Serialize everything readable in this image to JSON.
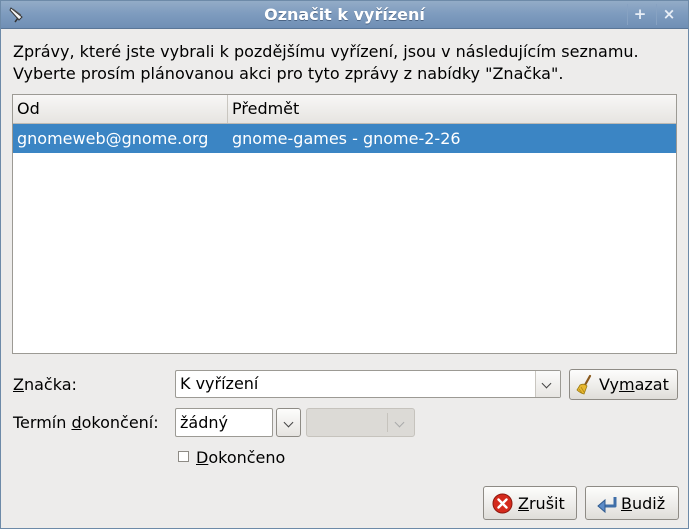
{
  "window": {
    "title": "Označit k vyřízení"
  },
  "intro": {
    "line1": "Zprávy, které jste vybrali k pozdějšímu vyřízení, jsou v následujícím seznamu.",
    "line2": "Vyberte prosím plánovanou akci pro tyto zprávy z nabídky \"Značka\"."
  },
  "list": {
    "columns": {
      "from": "Od",
      "subject": "Předmět"
    },
    "rows": [
      {
        "from": "gnomeweb@gnome.org",
        "subject": "gnome-games - gnome-2-26",
        "selected": true
      }
    ]
  },
  "flag": {
    "label_mnemonic": "Z",
    "label_rest": "načka:",
    "value": "K vyřízení"
  },
  "clear_button": {
    "label_pre": "Vy",
    "label_mnemonic": "m",
    "label_post": "azat"
  },
  "due": {
    "label_pre": "Termín ",
    "label_mnemonic": "d",
    "label_post": "okončení:",
    "date_value": "žádný",
    "time_value": ""
  },
  "completed": {
    "label_mnemonic": "D",
    "label_rest": "okončeno",
    "checked": false
  },
  "cancel_button": {
    "label_mnemonic": "Z",
    "label_rest": "rušit"
  },
  "ok_button": {
    "label_mnemonic": "B",
    "label_rest": "udiž"
  },
  "colors": {
    "titlebar": "#7f9cbf",
    "selection": "#3b85c4",
    "window_bg": "#edeceb",
    "cancel_icon": "#d42a1c"
  }
}
